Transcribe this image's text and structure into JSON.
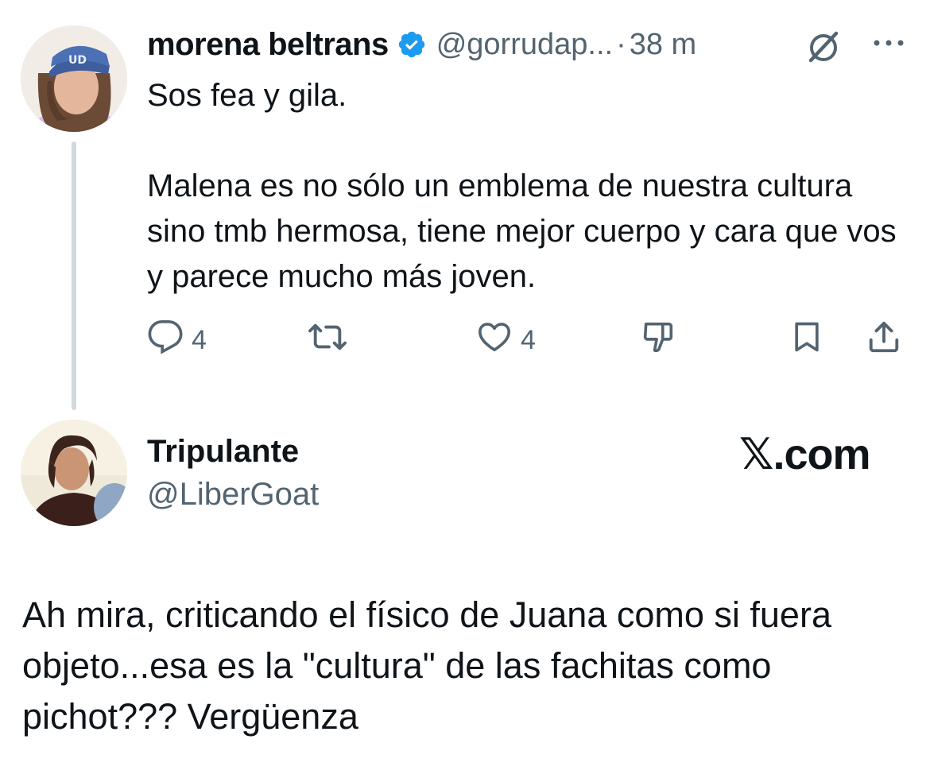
{
  "tweet": {
    "author": {
      "display_name": "morena beltrans",
      "handle": "@gorrudap...",
      "verified": true,
      "verified_color": "#1d9bf0"
    },
    "separator": "·",
    "time": "38 m",
    "body": {
      "line1": "Sos fea y gila.",
      "para2": "Malena es no sólo un emblema de nuestra cultura sino tmb hermosa, tiene mejor cuerpo y cara que vos y parece mucho más joven."
    },
    "actions": {
      "reply_icon": "reply-icon",
      "reply_count": "4",
      "retweet_icon": "retweet-icon",
      "like_icon": "heart-icon",
      "like_count": "4",
      "dislike_icon": "dislike-icon",
      "bookmark_icon": "bookmark-icon",
      "share_icon": "share-icon"
    }
  },
  "quote": {
    "display_name": "Tripulante",
    "handle": "@LiberGoat",
    "watermark": "𝕏.com",
    "text": "Ah mira, criticando el físico de Juana como si fuera objeto...esa es la \"cultura\" de las fachitas como pichot??? Vergüenza"
  },
  "colors": {
    "text_primary": "#0f1419",
    "text_secondary": "#536471",
    "thread_line": "#cfd9de"
  }
}
